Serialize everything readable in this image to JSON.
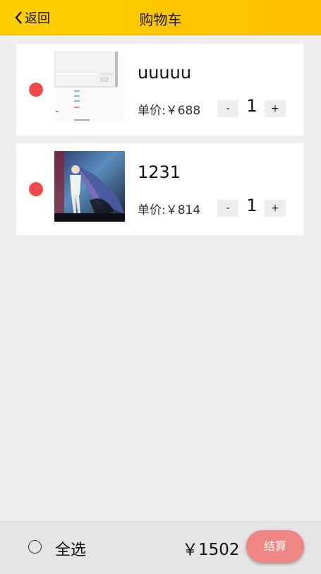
{
  "header": {
    "back_label": "返回",
    "title": "购物车"
  },
  "items": [
    {
      "name": "uuuuu",
      "price": "单价:￥688",
      "minus": "-",
      "qty": "1",
      "plus": "+"
    },
    {
      "name": "1231",
      "price": "单价:￥814",
      "minus": "-",
      "qty": "1",
      "plus": "+"
    }
  ],
  "footer": {
    "select_all": "全选",
    "total": "￥1502",
    "checkout": "结算"
  },
  "colors": {
    "header": "#ffc800",
    "dot": "#f24a4a",
    "checkout": "#f08683",
    "background": "#efeeed"
  }
}
